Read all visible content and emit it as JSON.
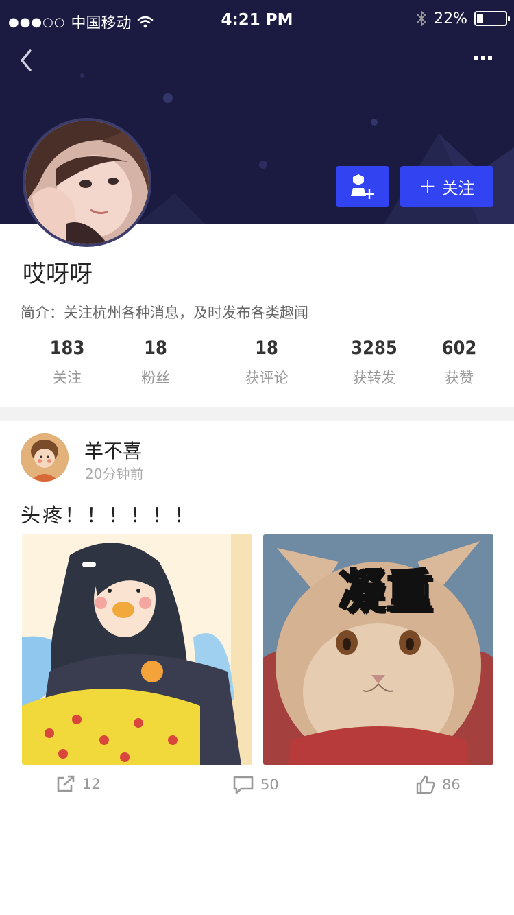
{
  "status_bar": {
    "signal": "●●●○○",
    "carrier": "中国移动",
    "time": "4:21 PM",
    "battery": "22%",
    "battery_level": 0.22
  },
  "nav": {
    "back_icon": "chevron-left-icon",
    "more_icon": "ellipsis-icon"
  },
  "profile": {
    "name": "哎呀呀",
    "bio": "简介：关注杭州各种消息，及时发布各类趣闻",
    "add_friend_icon": "add-user-icon",
    "follow_plus": "+",
    "follow_label": "关注",
    "stats": [
      {
        "value": "183",
        "label": "关注"
      },
      {
        "value": "18",
        "label": "粉丝"
      },
      {
        "value": "18",
        "label": "获评论"
      },
      {
        "value": "3285",
        "label": "获转发"
      },
      {
        "value": "602",
        "label": "获赞"
      }
    ]
  },
  "post": {
    "author": "羊不喜",
    "time": "20分钟前",
    "text": "头疼！！！！！！",
    "image_caption": "凝重",
    "actions": {
      "share_count": "12",
      "comment_count": "50",
      "like_count": "86"
    }
  },
  "colors": {
    "header_bg": "#1b1b42",
    "accent": "#3243f2",
    "divider": "#f2f2f2"
  }
}
